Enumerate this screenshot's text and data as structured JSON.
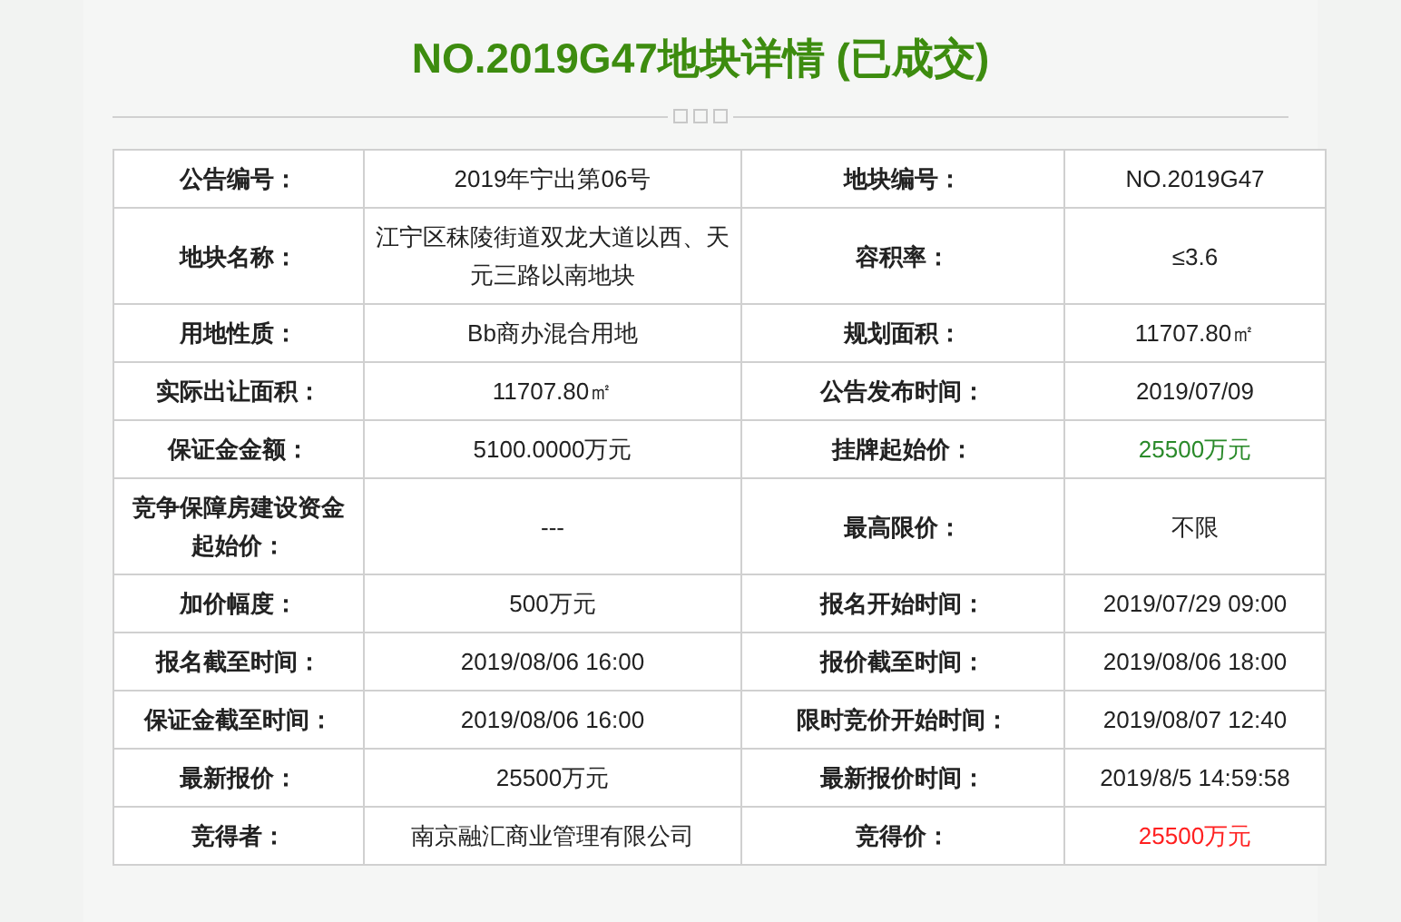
{
  "title": "NO.2019G47地块详情 (已成交)",
  "rows": [
    {
      "cells": [
        {
          "label": "公告编号：",
          "value": "2019年宁出第06号"
        },
        {
          "label": "地块编号：",
          "value": "NO.2019G47"
        }
      ]
    },
    {
      "cells": [
        {
          "label": "地块名称：",
          "value": "江宁区秣陵街道双龙大道以西、天元三路以南地块"
        },
        {
          "label": "容积率：",
          "value": "≤3.6"
        }
      ]
    },
    {
      "cells": [
        {
          "label": "用地性质：",
          "value": "Bb商办混合用地"
        },
        {
          "label": "规划面积：",
          "value": "11707.80㎡"
        }
      ]
    },
    {
      "cells": [
        {
          "label": "实际出让面积：",
          "value": "11707.80㎡"
        },
        {
          "label": "公告发布时间：",
          "value": "2019/07/09"
        }
      ]
    },
    {
      "cells": [
        {
          "label": "保证金金额：",
          "value": "5100.0000万元"
        },
        {
          "label": "挂牌起始价：",
          "value": "25500万元",
          "color": "#2a8a2a"
        }
      ]
    },
    {
      "cells": [
        {
          "label": "竞争保障房建设资金起始价：",
          "value": "---"
        },
        {
          "label": "最高限价：",
          "value": "不限"
        }
      ]
    },
    {
      "cells": [
        {
          "label": "加价幅度：",
          "value": "500万元"
        },
        {
          "label": "报名开始时间：",
          "value": "2019/07/29 09:00"
        }
      ]
    },
    {
      "cells": [
        {
          "label": "报名截至时间：",
          "value": "2019/08/06 16:00"
        },
        {
          "label": "报价截至时间：",
          "value": "2019/08/06 18:00"
        }
      ]
    },
    {
      "cells": [
        {
          "label": "保证金截至时间：",
          "value": "2019/08/06 16:00"
        },
        {
          "label": "限时竞价开始时间：",
          "value": "2019/08/07 12:40"
        }
      ]
    },
    {
      "cells": [
        {
          "label": "最新报价：",
          "value": "25500万元"
        },
        {
          "label": "最新报价时间：",
          "value": "2019/8/5 14:59:58"
        }
      ]
    },
    {
      "cells": [
        {
          "label": "竞得者：",
          "value": "南京融汇商业管理有限公司"
        },
        {
          "label": "竞得价：",
          "value": "25500万元",
          "color": "#ff2020"
        }
      ]
    }
  ]
}
